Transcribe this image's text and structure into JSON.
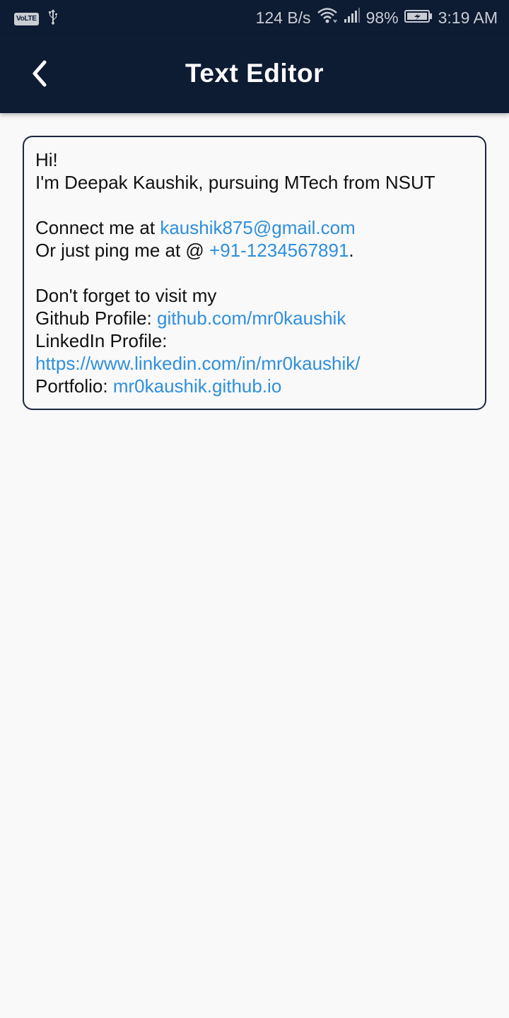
{
  "status_bar": {
    "carrier_badge": "VoLTE",
    "net_speed": "124 B/s",
    "battery": "98%",
    "time": "3:19 AM",
    "icons": [
      "volte-icon",
      "usb-icon",
      "wifi-icon",
      "signal-icon",
      "battery-charging-icon"
    ]
  },
  "app_bar": {
    "title": "Text Editor",
    "back_icon": "chevron-left-icon"
  },
  "colors": {
    "app_bar_bg": "#0d1b33",
    "link": "#2f8fdc",
    "text": "#111111",
    "background": "#f9f9f9"
  },
  "editor": {
    "greeting": "Hi!",
    "intro": "I'm Deepak Kaushik, pursuing MTech from NSUT",
    "connect_prefix": "Connect me at ",
    "email": "kaushik875@gmail.com",
    "ping_prefix": "Or just ping me at @ ",
    "phone": "+91-1234567891",
    "ping_suffix": ".",
    "visit": "Don't forget to visit my",
    "github_label": "Github Profile: ",
    "github_link": "github.com/mr0kaushik",
    "linkedin_label": "LinkedIn Profile:",
    "linkedin_link": "https://www.linkedin.com/in/mr0kaushik/",
    "portfolio_label": "Portfolio: ",
    "portfolio_link": "mr0kaushik.github.io"
  }
}
